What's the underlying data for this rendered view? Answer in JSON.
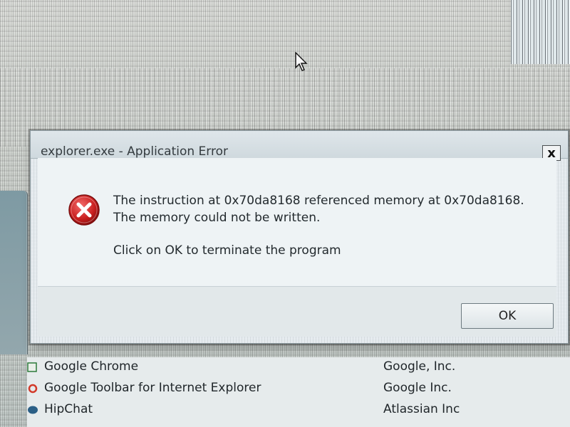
{
  "dialog": {
    "title": "explorer.exe - Application Error",
    "close_label": "x",
    "icon": "error-icon",
    "message": "The instruction at 0x70da8168 referenced memory at 0x70da8168. The memory could not be written.",
    "instruction": "Click on OK to terminate the program",
    "ok_label": "OK"
  },
  "programs": [
    {
      "name": "Google Chrome",
      "publisher": "Google, Inc.",
      "icon": "chrome-icon"
    },
    {
      "name": "Google Toolbar for Internet Explorer",
      "publisher": "Google Inc.",
      "icon": "toolbar-icon"
    },
    {
      "name": "HipChat",
      "publisher": "Atlassian Inc",
      "icon": "hipchat-icon"
    }
  ],
  "colors": {
    "error_red": "#c81e1e",
    "dialog_bg": "#e4eaee"
  }
}
